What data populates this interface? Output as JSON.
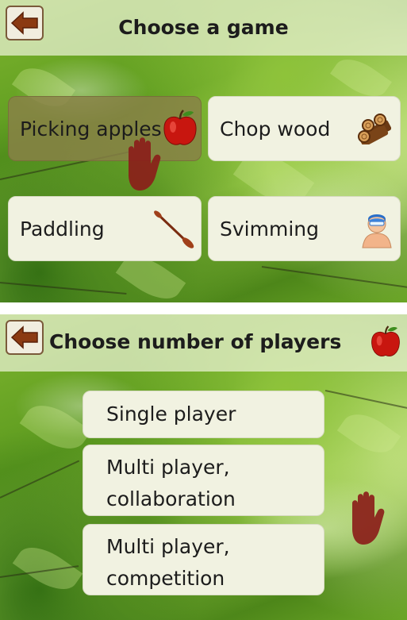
{
  "top_screen": {
    "title": "Choose a game",
    "back_icon": "arrow-left-icon",
    "games": [
      {
        "label": "Picking apples",
        "icon": "apple-icon",
        "selected": true
      },
      {
        "label": "Chop wood",
        "icon": "logs-icon",
        "selected": false
      },
      {
        "label": "Paddling",
        "icon": "paddle-icon",
        "selected": false
      },
      {
        "label": "Svimming",
        "icon": "swimmer-icon",
        "selected": false
      }
    ]
  },
  "bottom_screen": {
    "title": "Choose number of players",
    "back_icon": "arrow-left-icon",
    "title_icon": "apple-icon",
    "options": [
      {
        "line1": "Single player"
      },
      {
        "line1": "Multi player,",
        "line2": "collaboration"
      },
      {
        "line1": "Multi player,",
        "line2": "competition"
      }
    ]
  },
  "colors": {
    "card_bg": "#f1f2e1",
    "selected_card_bg": "#8a8048",
    "hand_color": "#8b1e1a",
    "back_arrow": "#8b3a12"
  }
}
